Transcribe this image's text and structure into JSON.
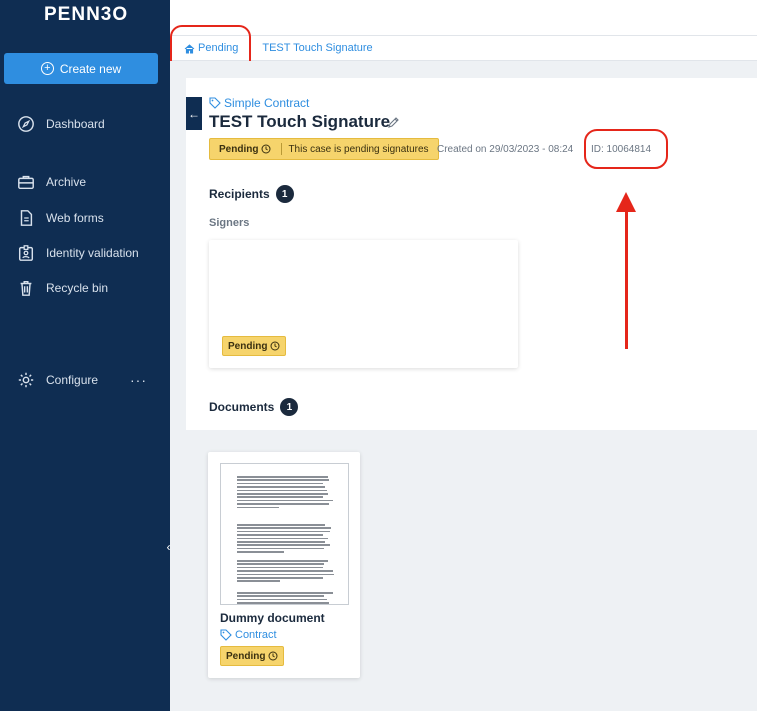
{
  "sidebar": {
    "logo": "PENN3O",
    "create_new": "Create new",
    "items": [
      {
        "label": "Dashboard",
        "icon": "compass-icon"
      },
      {
        "label": "Archive",
        "icon": "briefcase-icon"
      },
      {
        "label": "Web forms",
        "icon": "document-icon"
      },
      {
        "label": "Identity validation",
        "icon": "id-badge-icon"
      },
      {
        "label": "Recycle bin",
        "icon": "trash-icon"
      },
      {
        "label": "Configure",
        "icon": "gear-icon"
      }
    ],
    "more": "···"
  },
  "breadcrumb": {
    "home": "Pending",
    "current": "TEST Touch Signature"
  },
  "case": {
    "type": "Simple Contract",
    "title": "TEST Touch Signature",
    "status": "Pending",
    "status_message": "This case is pending signatures",
    "created": "Created on 29/03/2023 - 08:24",
    "id": "ID: 10064814"
  },
  "recipients": {
    "title": "Recipients",
    "count": "1",
    "signers_label": "Signers",
    "signer_status": "Pending"
  },
  "documents": {
    "title": "Documents",
    "count": "1",
    "items": [
      {
        "name": "Dummy document",
        "type": "Contract",
        "status": "Pending"
      }
    ]
  },
  "colors": {
    "sidebar": "#0f2d52",
    "accent": "#2f8ee0",
    "pending": "#f6d46c",
    "annotation": "#e5261a"
  }
}
